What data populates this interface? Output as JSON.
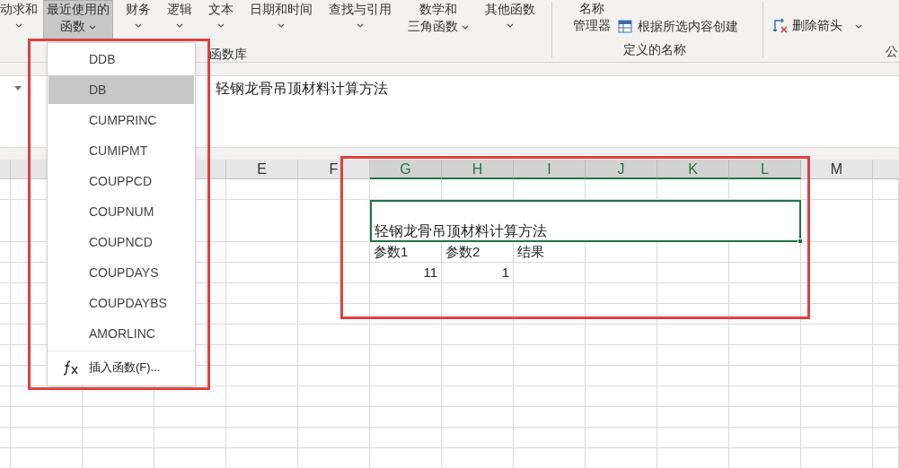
{
  "ribbon": {
    "commands": [
      {
        "lines": [
          "动求和"
        ],
        "dropdown": true,
        "selected": false
      },
      {
        "lines": [
          "最近使用的",
          "函数"
        ],
        "dropdown": true,
        "selected": true
      },
      {
        "lines": [
          "财务"
        ],
        "dropdown": true,
        "selected": false
      },
      {
        "lines": [
          "逻辑"
        ],
        "dropdown": true,
        "selected": false
      },
      {
        "lines": [
          "文本"
        ],
        "dropdown": true,
        "selected": false
      },
      {
        "lines": [
          "日期和时间"
        ],
        "dropdown": true,
        "selected": false
      },
      {
        "lines": [
          "查找与引用"
        ],
        "dropdown": true,
        "selected": false
      },
      {
        "lines": [
          "数学和",
          "三角函数"
        ],
        "dropdown": true,
        "selected": false
      },
      {
        "lines": [
          "其他函数"
        ],
        "dropdown": true,
        "selected": false
      }
    ],
    "group_label": "函数库",
    "names_group": {
      "manager": [
        "名称",
        "管理器"
      ],
      "create_from_selection": "根据所选内容创建",
      "label": "定义的名称"
    },
    "auditing_group": {
      "remove_arrows": "删除箭头",
      "label_fragment": "公"
    }
  },
  "formula_bar": {
    "content": "轻钢龙骨吊顶材料计算方法"
  },
  "recent_functions_menu": {
    "items": [
      {
        "label": "DDB",
        "selected": false
      },
      {
        "label": "DB",
        "selected": true
      },
      {
        "label": "CUMPRINC",
        "selected": false
      },
      {
        "label": "CUMIPMT",
        "selected": false
      },
      {
        "label": "COUPPCD",
        "selected": false
      },
      {
        "label": "COUPNUM",
        "selected": false
      },
      {
        "label": "COUPNCD",
        "selected": false
      },
      {
        "label": "COUPDAYS",
        "selected": false
      },
      {
        "label": "COUPDAYBS",
        "selected": false
      },
      {
        "label": "AMORLINC",
        "selected": false
      }
    ],
    "insert_function": "插入函数(F)..."
  },
  "sheet": {
    "columns": [
      {
        "label": "E",
        "selected": false
      },
      {
        "label": "F",
        "selected": false
      },
      {
        "label": "G",
        "selected": true
      },
      {
        "label": "H",
        "selected": true
      },
      {
        "label": "I",
        "selected": true
      },
      {
        "label": "J",
        "selected": true
      },
      {
        "label": "K",
        "selected": true
      },
      {
        "label": "L",
        "selected": true
      },
      {
        "label": "M",
        "selected": false
      }
    ],
    "title_cell": "轻钢龙骨吊顶材料计算方法",
    "header_row": [
      "参数1",
      "参数2",
      "结果"
    ],
    "value_row": [
      "11",
      "1"
    ]
  }
}
